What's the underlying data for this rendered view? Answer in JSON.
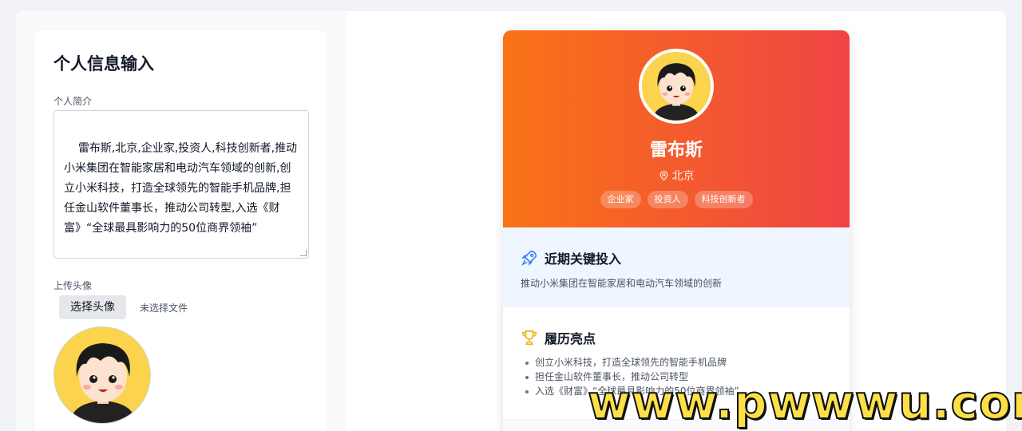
{
  "form": {
    "title": "个人信息输入",
    "bio_label": "个人简介",
    "bio_value": "雷布斯,北京,企业家,投资人,科技创新者,推动小米集团在智能家居和电动汽车领域的创新,创立小米科技，打造全球领先的智能手机品牌,担任金山软件董事长，推动公司转型,入选《财富》“全球最具影响力的50位商界领袖”",
    "avatar_label": "上传头像",
    "file_button": "选择头像",
    "file_status": "未选择文件"
  },
  "profile": {
    "name": "雷布斯",
    "location": "北京",
    "tags": [
      "企业家",
      "投资人",
      "科技创新者"
    ],
    "invest_title": "近期关键投入",
    "invest_text": "推动小米集团在智能家居和电动汽车领域的创新",
    "highlights_title": "履历亮点",
    "highlights": [
      "创立小米科技，打造全球领先的智能手机品牌",
      "担任金山软件董事长，推动公司转型",
      "入选《财富》“全球最具影响力的50位商界领袖”"
    ]
  },
  "colors": {
    "header_start": "#f97316",
    "header_end": "#ef4444",
    "invest_bg": "#eff6ff",
    "rocket_icon": "#3b82f6",
    "trophy_icon": "#eab308"
  },
  "watermark": "www.pwwwu.com"
}
